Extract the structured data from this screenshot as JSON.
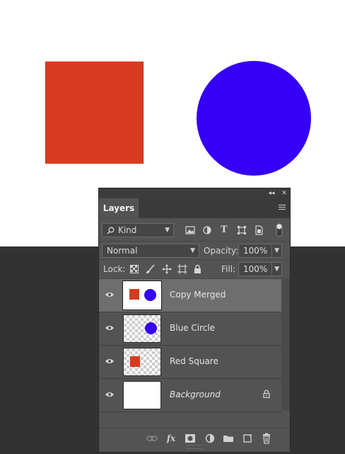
{
  "canvas": {
    "shapes": [
      {
        "name": "Red Square",
        "kind": "square",
        "color": "#d63b1f"
      },
      {
        "name": "Blue Circle",
        "kind": "circle",
        "color": "#3500f5"
      }
    ],
    "background": "#ffffff"
  },
  "panel": {
    "collapse_label": "◂◂",
    "close_label": "✕",
    "tab_label": "Layers",
    "filter": {
      "label": "Kind",
      "search_icon": "search-icon",
      "filter_icons": [
        "image-filter-icon",
        "adjustment-filter-icon",
        "type-filter-icon",
        "shape-filter-icon",
        "smart-object-filter-icon",
        "filter-toggle-icon"
      ]
    },
    "blend": {
      "mode": "Normal",
      "opacity_label": "Opacity:",
      "opacity_value": "100%"
    },
    "lock": {
      "label": "Lock:",
      "fill_label": "Fill:",
      "fill_value": "100%",
      "lock_icons": [
        "lock-transparent-pixels-icon",
        "lock-image-pixels-icon",
        "lock-position-icon",
        "lock-artboard-icon",
        "lock-all-icon"
      ]
    },
    "layers": [
      {
        "name": "Copy Merged",
        "selected": true,
        "thumb": "merged",
        "visible": true
      },
      {
        "name": "Blue Circle",
        "selected": false,
        "thumb": "circle",
        "visible": true
      },
      {
        "name": "Red Square",
        "selected": false,
        "thumb": "square",
        "visible": true
      },
      {
        "name": "Background",
        "selected": false,
        "thumb": "white",
        "visible": true,
        "locked": true
      }
    ],
    "bottom_icons": [
      "link-layers-icon",
      "fx-icon",
      "add-mask-icon",
      "adjustment-layer-icon",
      "new-group-icon",
      "new-layer-icon",
      "delete-layer-icon"
    ],
    "fx_label": "fx",
    "colors": {
      "panel": "#535353",
      "selected_row": "#6e6e6e",
      "dark_bg": "#323232"
    }
  }
}
